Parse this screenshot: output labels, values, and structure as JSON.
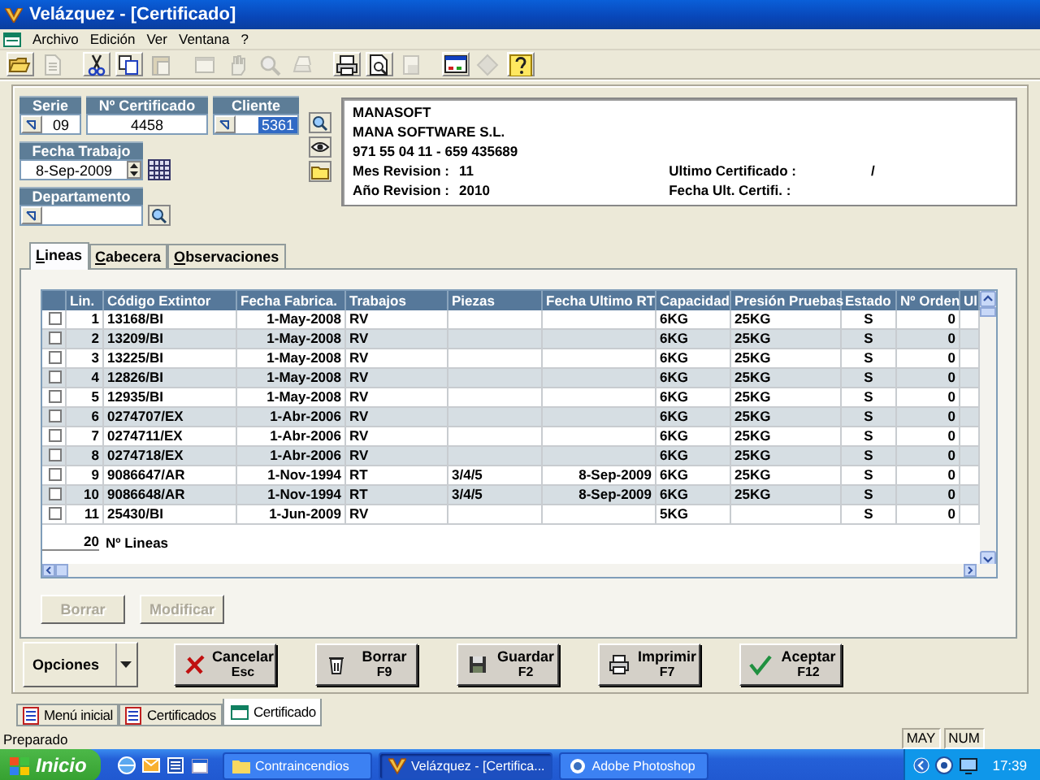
{
  "window": {
    "title": "Velázquez - [Certificado]"
  },
  "menu": [
    "Archivo",
    "Edición",
    "Ver",
    "Ventana",
    "?"
  ],
  "toolbar": [
    {
      "disabled": false
    },
    {
      "disabled": true
    },
    {
      "disabled": false
    },
    {
      "disabled": false
    },
    {
      "disabled": true
    },
    {
      "disabled": true
    },
    {
      "disabled": true
    },
    {
      "disabled": true
    },
    {
      "disabled": true
    },
    {
      "disabled": false
    },
    {
      "disabled": false
    },
    {
      "disabled": true
    },
    {
      "disabled": false
    },
    {
      "disabled": true
    },
    {
      "disabled": false
    }
  ],
  "form": {
    "serie": {
      "label": "Serie",
      "value": "09"
    },
    "certificado": {
      "label": "Nº Certificado",
      "value": "4458"
    },
    "cliente": {
      "label": "Cliente",
      "value": "5361",
      "highlighted": true
    },
    "fecha_trabajo": {
      "label": "Fecha Trabajo",
      "value": "8-Sep-2009"
    },
    "departamento": {
      "label": "Departamento"
    }
  },
  "info": {
    "lines": [
      "MANASOFT",
      "MANA SOFTWARE S.L.",
      "971 55 04 11 - 659 435689"
    ],
    "fields": [
      {
        "label": "Mes Revision :",
        "value": "11"
      },
      {
        "label": "Año Revision :",
        "value": "2010"
      },
      {
        "label": "Ultimo Certificado :",
        "value": "/"
      },
      {
        "label": "Fecha Ult. Certifi. :"
      }
    ]
  },
  "tabs": [
    {
      "label": "Lineas",
      "selected": true
    },
    {
      "label": "Cabecera",
      "selected": false
    },
    {
      "label": "Observaciones",
      "selected": false
    }
  ],
  "table": {
    "columns": [
      "Lin.",
      "Código Extintor",
      "Fecha Fabrica.",
      "Trabajos",
      "Piezas",
      "Fecha Ultimo RT",
      "Capacidad",
      "Presión Pruebas",
      "Estado",
      "Nº Orden",
      "Ul"
    ],
    "rows": [
      {
        "checked": false,
        "cells": [
          "1",
          "13168/BI",
          "1-May-2008",
          "RV",
          null,
          null,
          "6KG",
          "25KG",
          "S",
          "0"
        ]
      },
      {
        "checked": false,
        "cells": [
          "2",
          "13209/BI",
          "1-May-2008",
          "RV",
          null,
          null,
          "6KG",
          "25KG",
          "S",
          "0"
        ]
      },
      {
        "checked": false,
        "cells": [
          "3",
          "13225/BI",
          "1-May-2008",
          "RV",
          null,
          null,
          "6KG",
          "25KG",
          "S",
          "0"
        ]
      },
      {
        "checked": false,
        "cells": [
          "4",
          "12826/BI",
          "1-May-2008",
          "RV",
          null,
          null,
          "6KG",
          "25KG",
          "S",
          "0"
        ]
      },
      {
        "checked": false,
        "cells": [
          "5",
          "12935/BI",
          "1-May-2008",
          "RV",
          null,
          null,
          "6KG",
          "25KG",
          "S",
          "0"
        ]
      },
      {
        "checked": false,
        "cells": [
          "6",
          "0274707/EX",
          "1-Abr-2006",
          "RV",
          null,
          null,
          "6KG",
          "25KG",
          "S",
          "0"
        ]
      },
      {
        "checked": false,
        "cells": [
          "7",
          "0274711/EX",
          "1-Abr-2006",
          "RV",
          null,
          null,
          "6KG",
          "25KG",
          "S",
          "0"
        ]
      },
      {
        "checked": false,
        "cells": [
          "8",
          "0274718/EX",
          "1-Abr-2006",
          "RV",
          null,
          null,
          "6KG",
          "25KG",
          "S",
          "0"
        ]
      },
      {
        "checked": false,
        "cells": [
          "9",
          "9086647/AR",
          "1-Nov-1994",
          "RT",
          "3/4/5",
          "8-Sep-2009",
          "6KG",
          "25KG",
          "S",
          "0"
        ]
      },
      {
        "checked": false,
        "cells": [
          "10",
          "9086648/AR",
          "1-Nov-1994",
          "RT",
          "3/4/5",
          "8-Sep-2009",
          "6KG",
          "25KG",
          "S",
          "0"
        ]
      },
      {
        "checked": false,
        "cells": [
          "11",
          "25430/BI",
          "1-Jun-2009",
          "RV",
          null,
          null,
          "5KG",
          null,
          "S",
          "0"
        ]
      }
    ],
    "footer": {
      "count": "20",
      "label": "Nº Lineas"
    }
  },
  "panel_buttons": [
    {
      "label": "Borrar",
      "disabled": true
    },
    {
      "label": "Modificar",
      "disabled": true
    }
  ],
  "options": "Opciones",
  "actions": [
    {
      "label": "Cancelar",
      "key": "Esc"
    },
    {
      "label": "Borrar",
      "key": "F9"
    },
    {
      "label": "Guardar",
      "key": "F2"
    },
    {
      "label": "Imprimir",
      "key": "F7"
    },
    {
      "label": "Aceptar",
      "key": "F12"
    }
  ],
  "doc_tabs": [
    {
      "label": "Menú inicial",
      "selected": false
    },
    {
      "label": "Certificados",
      "selected": false
    },
    {
      "label": "Certificado",
      "selected": true
    }
  ],
  "status_bar": {
    "text": "Preparado",
    "indicators": [
      "MAY",
      "NUM"
    ]
  },
  "taskbar": {
    "start": "Inicio",
    "tasks": [
      {
        "label": "Contraincendios",
        "selected": false
      },
      {
        "label": "Velázquez - [Certifica...",
        "selected": true
      },
      {
        "label": "Adobe Photoshop",
        "selected": false
      }
    ],
    "clock": "17:39"
  }
}
